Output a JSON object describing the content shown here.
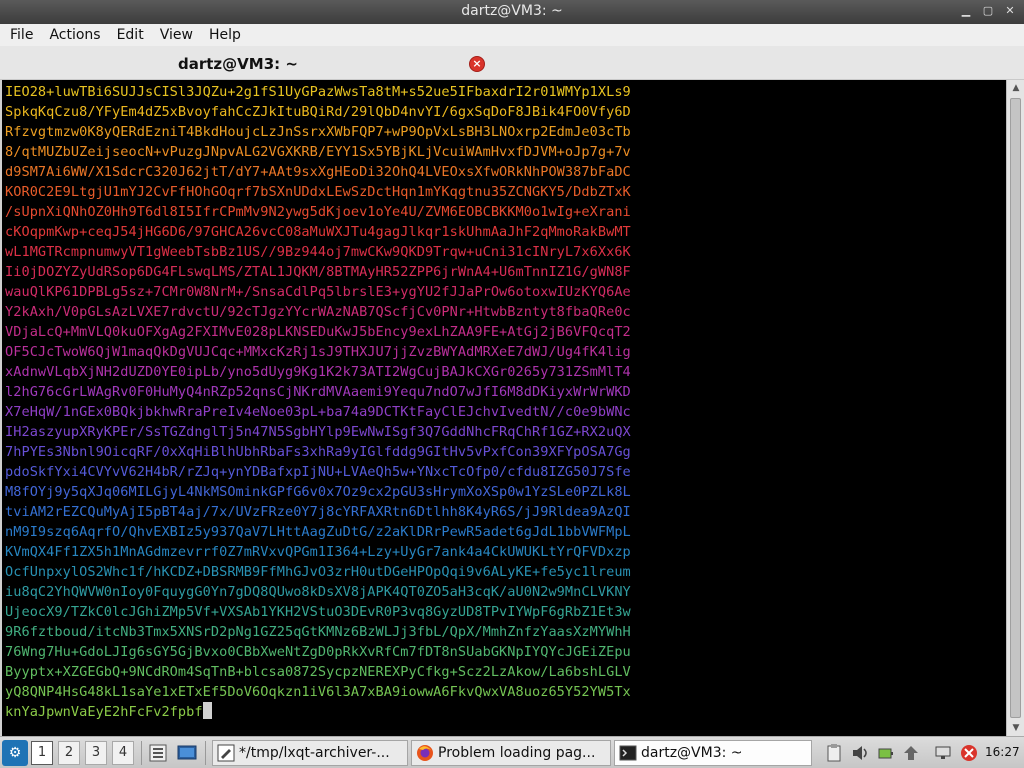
{
  "window": {
    "title": "dartz@VM3: ~"
  },
  "menu": [
    "File",
    "Actions",
    "Edit",
    "View",
    "Help"
  ],
  "tab": {
    "label": "dartz@VM3: ~"
  },
  "terminal": {
    "lines": [
      "IEO28+luwTBi6SUJJsCISl3JQZu+2g1fS1UyGPazWwsTa8tM+s52ue5IFbaxdrI2r01WMYp1XLs9",
      "SpkqKqCzu8/YFyEm4dZ5xBvoyfahCcZJkItuBQiRd/29lQbD4nvYI/6gxSqDoF8JBik4FO0Vfy6D",
      "Rfzvgtmzw0K8yQERdEzniT4BkdHoujcLzJnSsrxXWbFQP7+wP9OpVxLsBH3LNOxrp2EdmJe03cTb",
      "8/qtMUZbUZeijseocN+vPuzgJNpvALG2VGXKRB/EYY1Sx5YBjKLjVcuiWAmHvxfDJVM+oJp7g+7v",
      "d9SM7Ai6WW/X1SdcrC320J62jtT/dY7+AAt9sxXgHEoDi32OhQ4LVEOxsXfwORkNhPOW387bFaDC",
      "KOR0C2E9LtgjU1mYJ2CvFfHOhGOqrf7bSXnUDdxLEwSzDctHqn1mYKqgtnu35ZCNGKY5/DdbZTxK",
      "/sUpnXiQNhOZ0Hh9T6dl8I5IfrCPmMv9N2ywg5dKjoev1oYe4U/ZVM6EOBCBKKM0o1wIg+eXrani",
      "cKOqpmKwp+ceqJ54jHG6D6/97GHCA26vcC08aMuWXJTu4gagJlkqr1skUhmAaJhF2qMmoRakBwMT",
      "wL1MGTRcmpnumwyVT1gWeebTsbBz1US//9Bz944oj7mwCKw9QKD9Trqw+uCni31cINryL7x6Xx6K",
      "Ii0jDOZYZyUdRSop6DG4FLswqLMS/ZTAL1JQKM/8BTMAyHR52ZPP6jrWnA4+U6mTnnIZ1G/gWN8F",
      "wauQlKP61DPBLg5sz+7CMr0W8NrM+/SnsaCdlPq5lbrslE3+ygYU2fJJaPrOw6otoxwIUzKYQ6Ae",
      "Y2kAxh/V0pGLsAzLVXE7rdvctU/92cTJgzYYcrWAzNAB7QScfjCv0PNr+HtwbBzntyt8fbaQRe0c",
      "VDjaLcQ+MmVLQ0kuOFXgAg2FXIMvE028pLKNSEDuKwJ5bEncy9exLhZAA9FE+AtGj2jB6VFQcqT2",
      "OF5CJcTwoW6QjW1maqQkDgVUJCqc+MMxcKzRj1sJ9THXJU7jjZvzBWYAdMRXeE7dWJ/Ug4fK4lig",
      "xAdnwVLqbXjNH2dUZD0YE0ipLb/yno5dUyg9Kg1K2k73ATI2WgCujBAJkCXGr0265y731ZSmMlT4",
      "l2hG76cGrLWAgRv0F0HuMyQ4nRZp52qnsCjNKrdMVAaemi9Yequ7ndO7wJfI6M8dDKiyxWrWrWKD",
      "X7eHqW/1nGEx0BQkjbkhwRraPreIv4eNoe03pL+ba74a9DCTKtFayClEJchvIvedtN//c0e9bWNc",
      "IH2aszyupXRyKPEr/SsTGZdnglTj5n47N5SgbHYlp9EwNwISgf3Q7GddNhcFRqChRf1GZ+RX2uQX",
      "7hPYEs3Nbnl9OicqRF/0xXqHiBlhUbhRbaFs3xhRa9yIGlfddg9GItHv5vPxfCon39XFYpOSA7Gg",
      "pdoSkfYxi4CVYvV62H4bR/rZJq+ynYDBafxpIjNU+LVAeQh5w+YNxcTcOfp0/cfdu8IZG50J7Sfe",
      "M8fOYj9y5qXJq06MILGjyL4NkMSOminkGPfG6v0x7Oz9cx2pGU3sHrymXoXSp0w1YzSLe0PZLk8L",
      "tviAM2rEZCQuMyAjI5pBT4aj/7x/UVzFRze0Y7j8cYRFAXRtn6Dtlhh8K4yR6S/jJ9Rldea9AzQI",
      "nM9I9szq6AqrfO/QhvEXBIz5y937QaV7LHttAagZuDtG/z2aKlDRrPewR5adet6gJdL1bbVWFMpL",
      "KVmQX4Ff1ZX5h1MnAGdmzevrrf0Z7mRVxvQPGm1I364+Lzy+UyGr7ank4a4CkUWUKLtYrQFVDxzp",
      "OcfUnpxylOS2Whc1f/hKCDZ+DBSRMB9FfMhGJvO3zrH0utDGeHPOpQqi9v6ALyKE+fe5yc1lreum",
      "iu8qC2YhQWVW0nIoy0FquygG0Yn7gDQ8QUwo8kDsXV8jAPK4QT0ZO5aH3cqK/aU0N2w9MnCLVKNY",
      "UjeocX9/TZkC0lcJGhiZMp5Vf+VXSAb1YKH2VStuO3DEvR0P3vq8GyzUD8TPvIYWpF6gRbZ1Et3w",
      "9R6fztboud/itcNb3Tmx5XNSrD2pNg1GZ25qGtKMNz6BzWLJj3fbL/QpX/MmhZnfzYaasXzMYWhH",
      "76Wng7Hu+GdoLJIg6sGY5GjBvxo0CBbXweNtZgD0pRkXvRfCm7fDT8nSUabGKNpIYQYcJGEiZEpu",
      "Byyptx+XZGEGbQ+9NCdROm4SqTnB+blcsa0872SycpzNEREXPyCfkg+Scz2LzAkow/La6bshLGLV",
      "yQ8QNP4HsG48kL1saYe1xETxEf5DoV6Oqkzn1iV6l3A7xBA9iowwA6FkvQwxVA8uoz65Y52YW5Tx",
      "knYaJpwnVaEyE2hFcFv2fpbf"
    ],
    "colors": [
      "#e8c321",
      "#ecb81f",
      "#ec9f22",
      "#ec8d24",
      "#ea7527",
      "#e85c2a",
      "#e64a30",
      "#e2393a",
      "#dd3047",
      "#d82d57",
      "#d22b66",
      "#cb2c78",
      "#c32d8a",
      "#b9309c",
      "#ae33ad",
      "#a039bc",
      "#8f3fc7",
      "#7c47d0",
      "#6650d6",
      "#545bd9",
      "#4266d8",
      "#3470d3",
      "#2a7bcb",
      "#2786c0",
      "#2891b3",
      "#2e9ba3",
      "#35a593",
      "#41ae82",
      "#50b671",
      "#62be61",
      "#76c553",
      "#8bcb48"
    ]
  },
  "taskbar": {
    "desktops": [
      "1",
      "2",
      "3",
      "4"
    ],
    "tasks": [
      {
        "label": "*/tmp/lxqt-archiver-..."
      },
      {
        "label": "Problem loading pag..."
      },
      {
        "label": "dartz@VM3: ~"
      }
    ],
    "clock": "16:27"
  }
}
